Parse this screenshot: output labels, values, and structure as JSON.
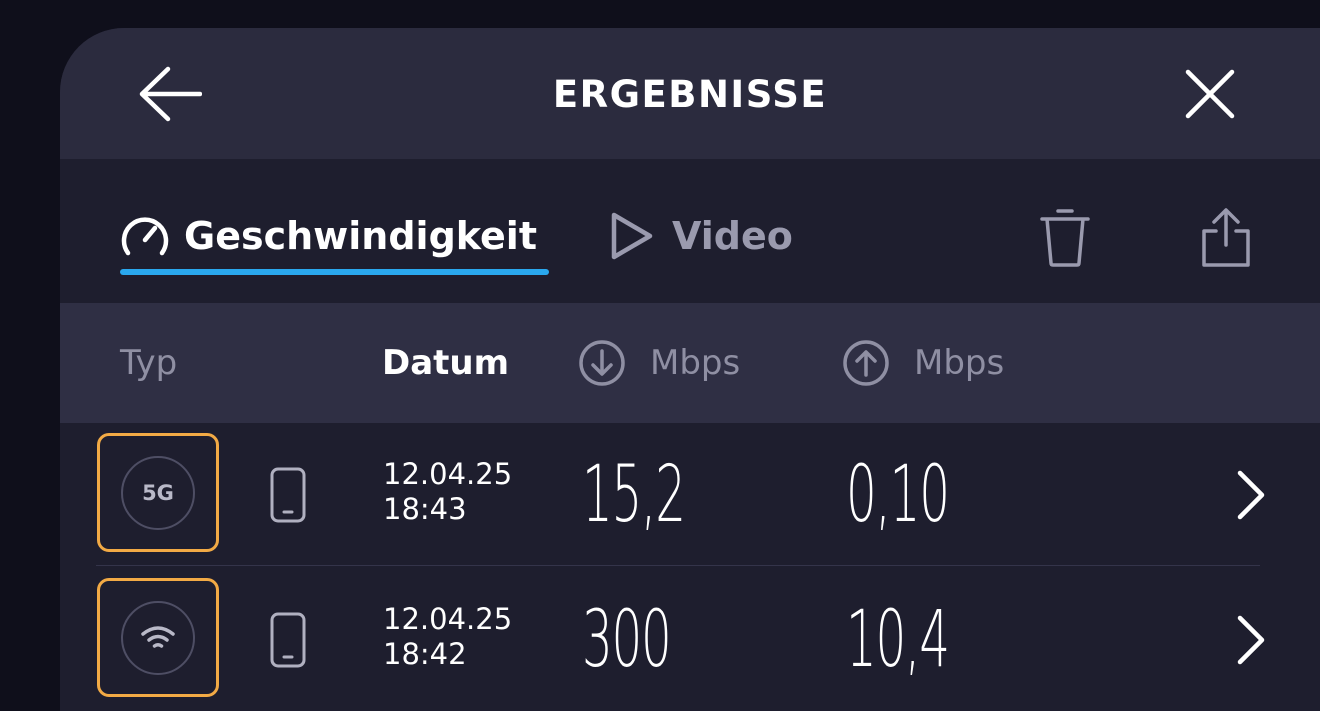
{
  "header": {
    "title": "ERGEBNISSE",
    "back_icon": "arrow-left-icon",
    "close_icon": "close-icon"
  },
  "tabs": [
    {
      "label": "Geschwindigkeit",
      "icon": "speedometer-icon",
      "active": true
    },
    {
      "label": "Video",
      "icon": "play-icon",
      "active": false
    }
  ],
  "toolbar": {
    "delete_icon": "trash-icon",
    "share_icon": "share-icon"
  },
  "columns": {
    "type": "Typ",
    "date": "Datum",
    "download": "Mbps",
    "upload": "Mbps"
  },
  "rows": [
    {
      "type_label": "5G",
      "type_icon": "5g-icon",
      "device_icon": "phone-icon",
      "date": "12.04.25",
      "time": "18:43",
      "download": "15,2",
      "upload": "0,10"
    },
    {
      "type_label": "",
      "type_icon": "wifi-icon",
      "device_icon": "phone-icon",
      "date": "12.04.25",
      "time": "18:42",
      "download": "300",
      "upload": "10,4"
    }
  ],
  "colors": {
    "accent": "#2aa8ee",
    "highlight": "#f2aa45",
    "header_bg": "#2b2b3e",
    "panel_bg": "#1e1e2e"
  }
}
